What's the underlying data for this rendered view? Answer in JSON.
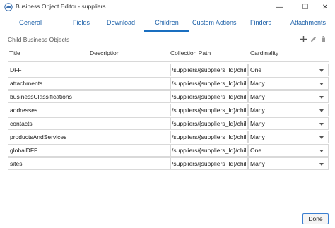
{
  "window": {
    "title": "Business Object Editor - suppliers",
    "minimize_glyph": "—",
    "maximize_glyph": "☐",
    "close_glyph": "✕"
  },
  "tabs": [
    {
      "label": "General"
    },
    {
      "label": "Fields"
    },
    {
      "label": "Download"
    },
    {
      "label": "Children",
      "active": true
    },
    {
      "label": "Custom Actions"
    },
    {
      "label": "Finders"
    },
    {
      "label": "Attachments"
    }
  ],
  "section": {
    "title": "Child Business Objects",
    "add_icon": "plus-icon",
    "edit_icon": "pencil-icon",
    "delete_icon": "trash-icon"
  },
  "table": {
    "headers": [
      "Title",
      "Description",
      "Collection Path",
      "Cardinality"
    ],
    "rows": [
      {
        "title": "DFF",
        "path": "/suppliers/{suppliers_Id}/chil",
        "cardinality": "One"
      },
      {
        "title": "attachments",
        "path": "/suppliers/{suppliers_Id}/chil",
        "cardinality": "Many"
      },
      {
        "title": "businessClassifications",
        "path": "/suppliers/{suppliers_Id}/chil",
        "cardinality": "Many"
      },
      {
        "title": "addresses",
        "path": "/suppliers/{suppliers_Id}/chil",
        "cardinality": "Many"
      },
      {
        "title": "contacts",
        "path": "/suppliers/{suppliers_Id}/chil",
        "cardinality": "Many"
      },
      {
        "title": "productsAndServices",
        "path": "/suppliers/{suppliers_Id}/chil",
        "cardinality": "Many"
      },
      {
        "title": "globalDFF",
        "path": "/suppliers/{suppliers_Id}/chil",
        "cardinality": "One"
      },
      {
        "title": "sites",
        "path": "/suppliers/{suppliers_Id}/chil",
        "cardinality": "Many"
      }
    ]
  },
  "footer": {
    "done_label": "Done"
  },
  "colors": {
    "accent": "#1a6fc0",
    "tab_text": "#1a5fa8"
  }
}
